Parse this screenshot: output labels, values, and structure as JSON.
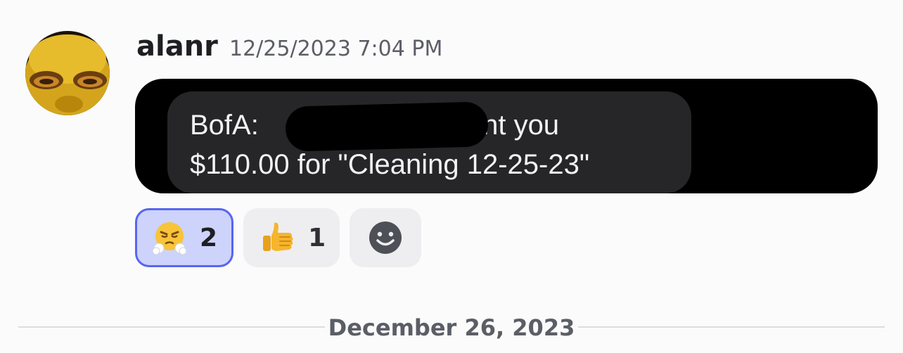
{
  "message": {
    "author": "alanr",
    "timestamp": "12/25/2023 7:04 PM",
    "avatar_icon": "alien-avatar-icon",
    "attachment": {
      "line1_prefix": "BofA:",
      "line1_suffix": "sent you",
      "line2": "$110.00 for \"Cleaning 12-25-23\""
    }
  },
  "reactions": [
    {
      "emoji": "face-with-steam-from-nose-icon",
      "count": "2",
      "active": true
    },
    {
      "emoji": "thumbs-up-icon",
      "count": "1",
      "active": false
    }
  ],
  "add_reaction_icon": "smiley-add-reaction-icon",
  "date_divider": "December 26, 2023",
  "colors": {
    "accent": "#5865f2",
    "active_reaction_bg": "#cdd3fb",
    "reaction_bg": "#eeeef1",
    "bubble": "#262629"
  }
}
